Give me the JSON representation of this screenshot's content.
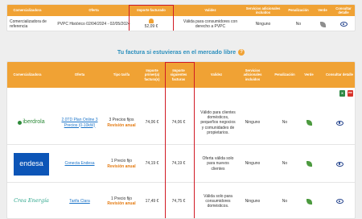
{
  "top_table": {
    "headers": [
      "Comercializadora",
      "Oferta",
      "Importe facturado",
      "Validez",
      "Servicios adicionales incluidos",
      "Penalización",
      "Verde",
      "Consultar detalle"
    ],
    "row": {
      "comercializadora": "Comercializadora de referencia",
      "oferta": "PVPC Histórico 02/04/2024 - 02/05/2024",
      "importe": "52,09 €",
      "validez": "Válida para consumidores con derecho a PVPC",
      "servicios": "Ninguno",
      "penalizacion": "No"
    }
  },
  "section_title": "Tu factura si estuvieras en el mercado libre",
  "export_icons": {
    "excel": "X",
    "pdf": "PDF"
  },
  "main_table": {
    "headers": [
      "Comercializadora",
      "Oferta",
      "Tipo tarifa",
      "Importe primer(a) factura(s)",
      "Importe siguientes facturas",
      "Validez",
      "Servicios adicionales incluidos",
      "Penalización",
      "Verde",
      "Consultar detalle"
    ],
    "rows": [
      {
        "logo": "iberdrola",
        "oferta": "2.0TD Plan Online 3 Precios (0-10kW)",
        "tipo": "3 Precios fijos",
        "revision": "Revisión anual",
        "importe_primera": "74,06 €",
        "importe_siguientes": "74,06 €",
        "validez": "Válido para clientes domésticos, pequeños negocios y comunidades de propietarios.",
        "servicios": "Ninguno",
        "penalizacion": "No"
      },
      {
        "logo": "endesa",
        "oferta": "Conecta Endesa",
        "tipo": "1 Precio fijo",
        "revision": "Revisión anual",
        "importe_primera": "74,19 €",
        "importe_siguientes": "74,19 €",
        "validez": "Oferta válida solo para nuevos clientes",
        "servicios": "Ninguno",
        "penalizacion": "No"
      },
      {
        "logo": "Crea Energía",
        "oferta": "Tarifa Clara",
        "tipo": "1 Precio fijo",
        "revision": "Revisión anual",
        "importe_primera": "17,49 €",
        "importe_siguientes": "74,75 €",
        "validez": "Válida solo para consumidores domésticos.",
        "servicios": "Ninguno",
        "penalizacion": "No"
      }
    ]
  },
  "colors": {
    "header": "#f0a234",
    "highlight": "#d11a24",
    "link": "#1a73c8",
    "green": "#4c9a3f"
  }
}
